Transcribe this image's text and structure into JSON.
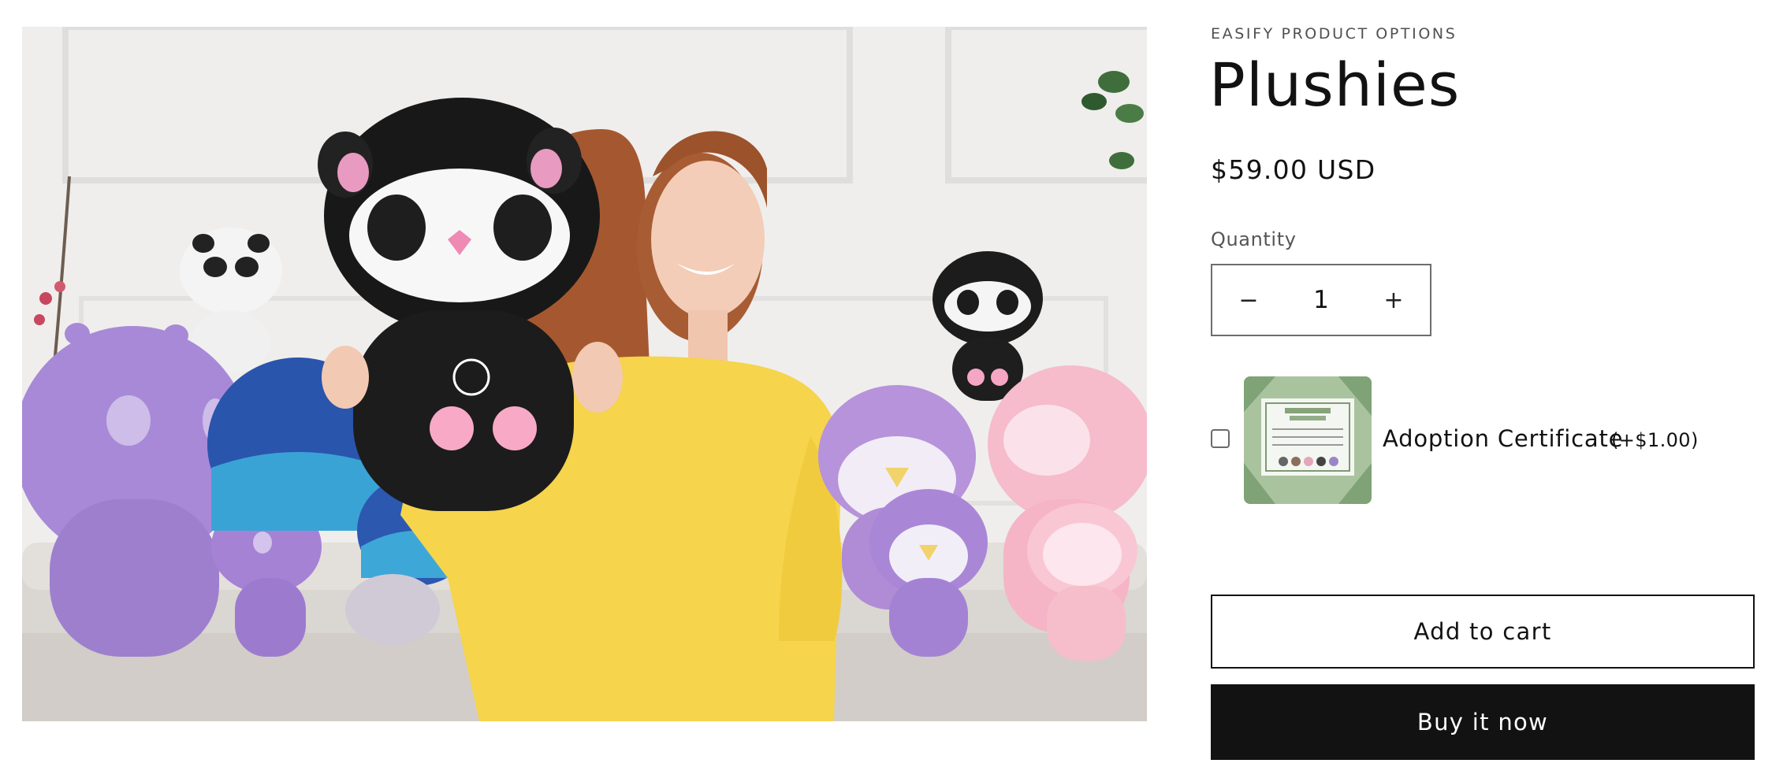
{
  "product": {
    "vendor": "EASIFY PRODUCT OPTIONS",
    "title": "Plushies",
    "price": "$59.00 USD"
  },
  "quantity": {
    "label": "Quantity",
    "value": "1",
    "decrease_symbol": "−",
    "increase_symbol": "+"
  },
  "addon": {
    "label": "Adoption Certificate",
    "price": "(+$1.00)",
    "checked": false,
    "image_alt": "adoption-certificate-thumbnail"
  },
  "actions": {
    "add_to_cart": "Add to cart",
    "buy_now": "Buy it now"
  },
  "media": {
    "image_subject": "product-photo-plushies",
    "colors": {
      "wall": "#ecebea",
      "sweater": "#f5d44a",
      "hair": "#a5582f",
      "black_plush": "#1a1a1a",
      "purple_plush": "#a98ad8",
      "pink_plush": "#f5b8c8",
      "blue_plush": "#2e5db4",
      "sofa": "#dcd8d4"
    }
  }
}
